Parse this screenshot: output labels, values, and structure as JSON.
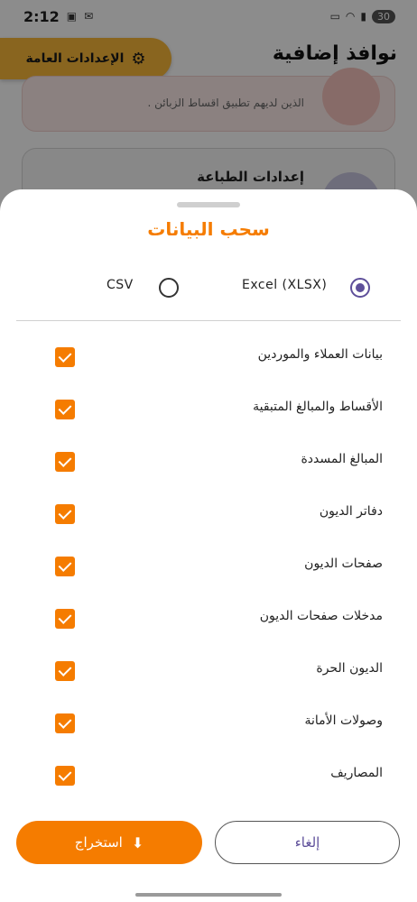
{
  "status_bar": {
    "time": "2:12",
    "battery": "30"
  },
  "background": {
    "page_title": "نوافذ إضافية",
    "general_settings_label": "الإعدادات العامة",
    "card1_desc": "الذين لديهم تطبيق اقساط الزبائن .",
    "card2_title": "إعدادات الطباعة"
  },
  "sheet": {
    "title": "سحب البيانات",
    "formats": {
      "xlsx_label": "Excel (XLSX)",
      "csv_label": "CSV",
      "selected": "xlsx"
    },
    "items": [
      {
        "label": "بيانات العملاء والموردين",
        "checked": true
      },
      {
        "label": "الأقساط والمبالغ المتبقية",
        "checked": true
      },
      {
        "label": "المبالغ المسددة",
        "checked": true
      },
      {
        "label": "دفاتر الديون",
        "checked": true
      },
      {
        "label": "صفحات الديون",
        "checked": true
      },
      {
        "label": "مدخلات صفحات الديون",
        "checked": true
      },
      {
        "label": "الديون الحرة",
        "checked": true
      },
      {
        "label": "وصولات الأمانة",
        "checked": true
      },
      {
        "label": "المصاريف",
        "checked": true
      }
    ],
    "extract_label": "استخراج",
    "cancel_label": "إلغاء"
  },
  "colors": {
    "accent": "#f57c00",
    "radio": "#5e4f9a",
    "settings_button": "#f9b83a"
  }
}
